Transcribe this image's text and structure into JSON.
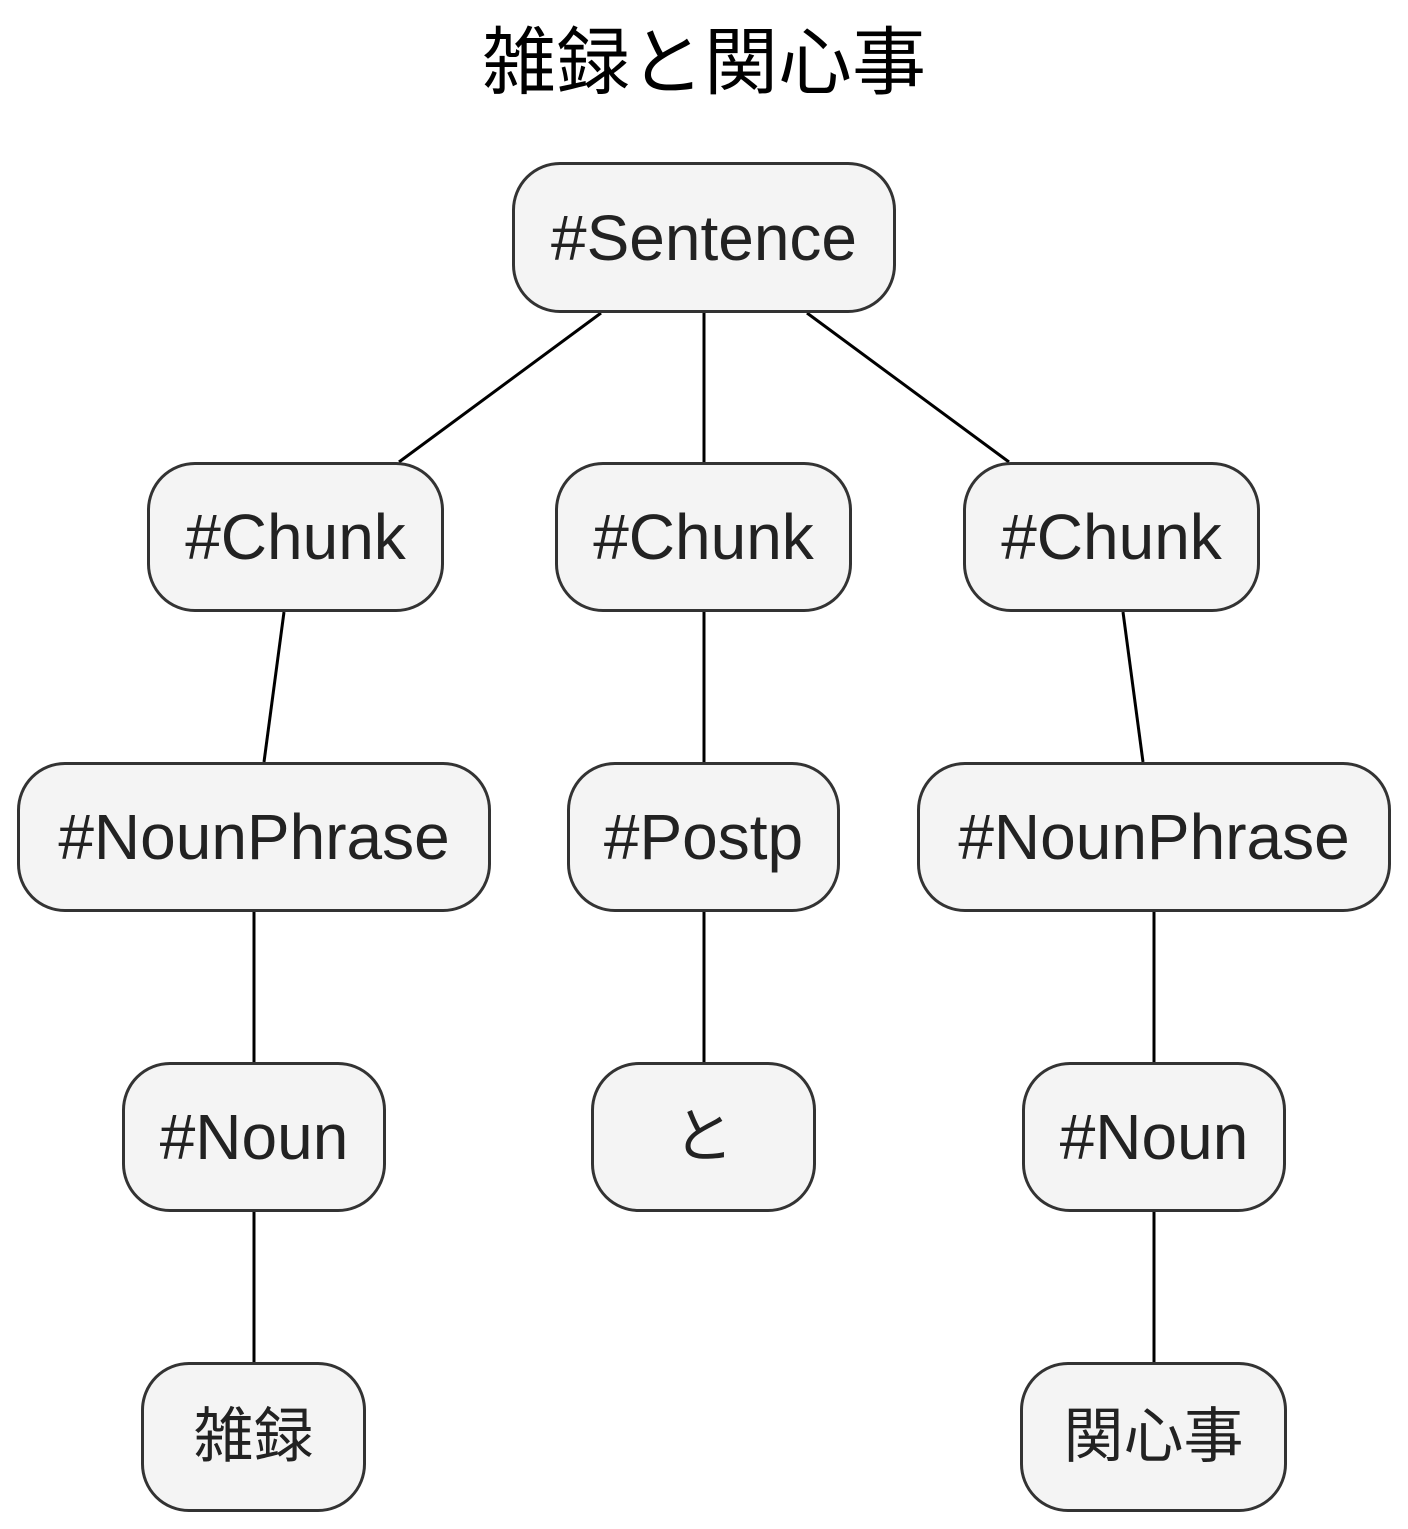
{
  "title": "雑録と関心事",
  "nodes": {
    "sentence": "#Sentence",
    "chunk_left": "#Chunk",
    "chunk_mid": "#Chunk",
    "chunk_right": "#Chunk",
    "nounphrase_left": "#NounPhrase",
    "postp": "#Postp",
    "nounphrase_right": "#NounPhrase",
    "noun_left": "#Noun",
    "to": "と",
    "noun_right": "#Noun",
    "leaf_left": "雑録",
    "leaf_right": "関心事"
  },
  "edges": [
    [
      "sentence",
      "chunk_left"
    ],
    [
      "sentence",
      "chunk_mid"
    ],
    [
      "sentence",
      "chunk_right"
    ],
    [
      "chunk_left",
      "nounphrase_left"
    ],
    [
      "chunk_mid",
      "postp"
    ],
    [
      "chunk_right",
      "nounphrase_right"
    ],
    [
      "nounphrase_left",
      "noun_left"
    ],
    [
      "postp",
      "to"
    ],
    [
      "nounphrase_right",
      "noun_right"
    ],
    [
      "noun_left",
      "leaf_left"
    ],
    [
      "noun_right",
      "leaf_right"
    ]
  ],
  "colors": {
    "node_fill": "#f4f4f4",
    "node_border": "#333333",
    "edge": "#000000",
    "text": "#222222"
  }
}
